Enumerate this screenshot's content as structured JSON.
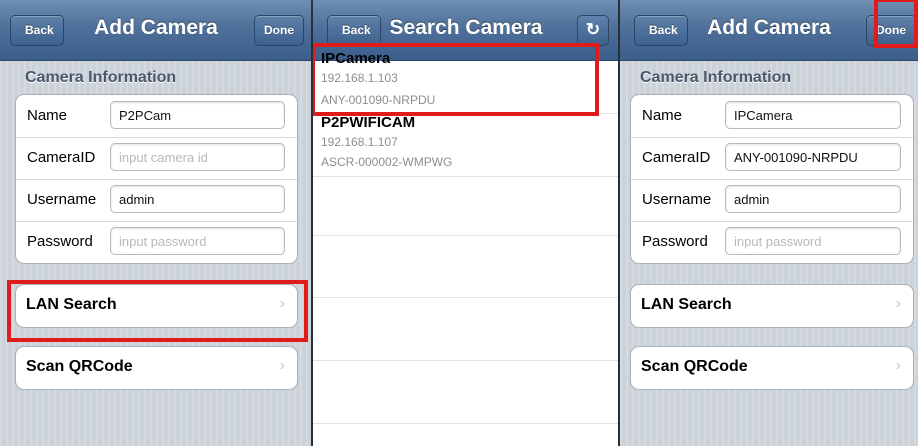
{
  "left_panel": {
    "title": "Add Camera",
    "back_label": "Back",
    "done_label": "Done",
    "section_header": "Camera Information",
    "fields": [
      {
        "label": "Name",
        "value": "P2PCam",
        "placeholder": ""
      },
      {
        "label": "CameraID",
        "value": "",
        "placeholder": "input camera id"
      },
      {
        "label": "Username",
        "value": "admin",
        "placeholder": ""
      },
      {
        "label": "Password",
        "value": "",
        "placeholder": "input password"
      }
    ],
    "lan_search_label": "LAN Search",
    "scan_qr_label": "Scan QRCode"
  },
  "middle_panel": {
    "title": "Search Camera",
    "back_label": "Back",
    "refresh_icon": "refresh-icon",
    "results": [
      {
        "name": "IPCamera",
        "ip": "192.168.1.103",
        "id": "ANY-001090-NRPDU"
      },
      {
        "name": "P2PWIFICAM",
        "ip": "192.168.1.107",
        "id": "ASCR-000002-WMPWG"
      }
    ]
  },
  "right_panel": {
    "title": "Add Camera",
    "back_label": "Back",
    "done_label": "Done",
    "section_header": "Camera Information",
    "fields": [
      {
        "label": "Name",
        "value": "IPCamera",
        "placeholder": ""
      },
      {
        "label": "CameraID",
        "value": "ANY-001090-NRPDU",
        "placeholder": ""
      },
      {
        "label": "Username",
        "value": "admin",
        "placeholder": ""
      },
      {
        "label": "Password",
        "value": "",
        "placeholder": "input password"
      }
    ],
    "lan_search_label": "LAN Search",
    "scan_qr_label": "Scan QRCode"
  },
  "colors": {
    "navbar": "#4f709a",
    "highlight": "#e01b1b",
    "grouped_bg": "#cbd2d8"
  }
}
